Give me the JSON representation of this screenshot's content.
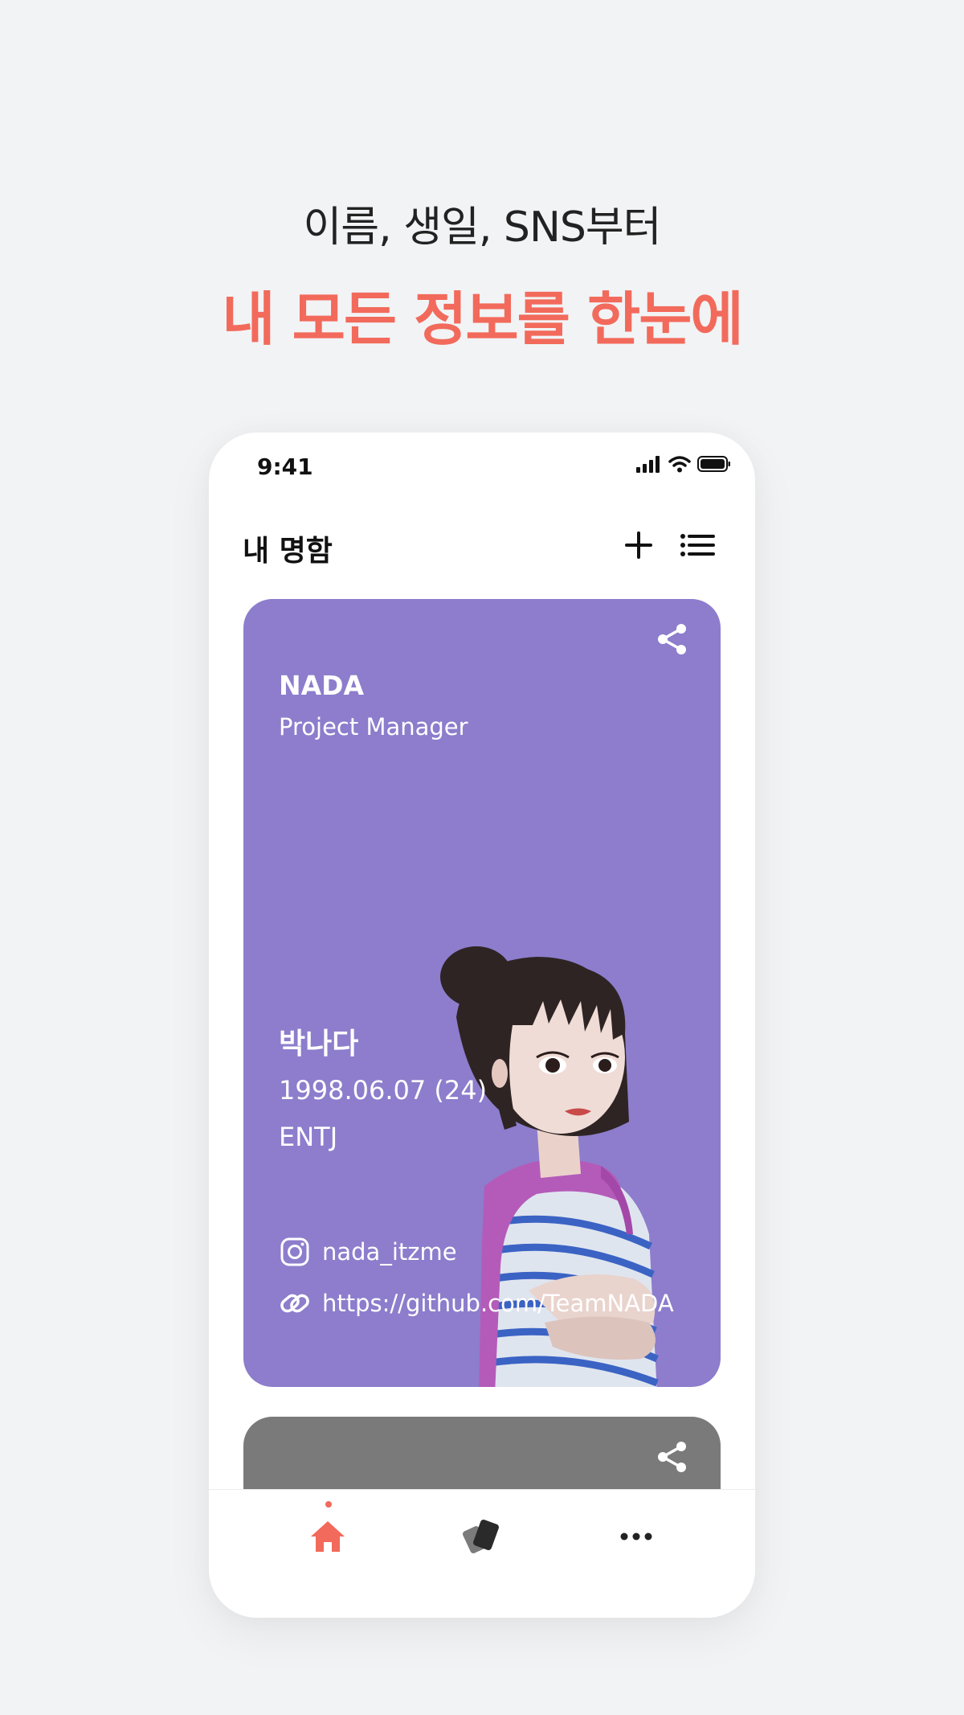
{
  "promo": {
    "subtitle": "이름, 생일, SNS부터",
    "title": "내 모든 정보를 한눈에"
  },
  "status_bar": {
    "time": "9:41"
  },
  "header": {
    "title": "내 명함",
    "add_icon": "plus-icon",
    "list_icon": "list-icon"
  },
  "card": {
    "background": "#8d7dcc",
    "name_en": "NADA",
    "role": "Project Manager",
    "name_kr": "박나다",
    "birth": "1998.06.07 (24)",
    "mbti": "ENTJ",
    "instagram": "nada_itzme",
    "github": "https://github.com/TeamNADA"
  },
  "second_card": {
    "background": "#7a7a7a"
  },
  "tabs": [
    {
      "name": "home",
      "icon": "home-icon",
      "active": true
    },
    {
      "name": "cards",
      "icon": "cards-icon",
      "active": false
    },
    {
      "name": "more",
      "icon": "more-icon",
      "active": false
    }
  ],
  "colors": {
    "accent": "#f26a5b",
    "page_bg": "#f2f3f5"
  }
}
